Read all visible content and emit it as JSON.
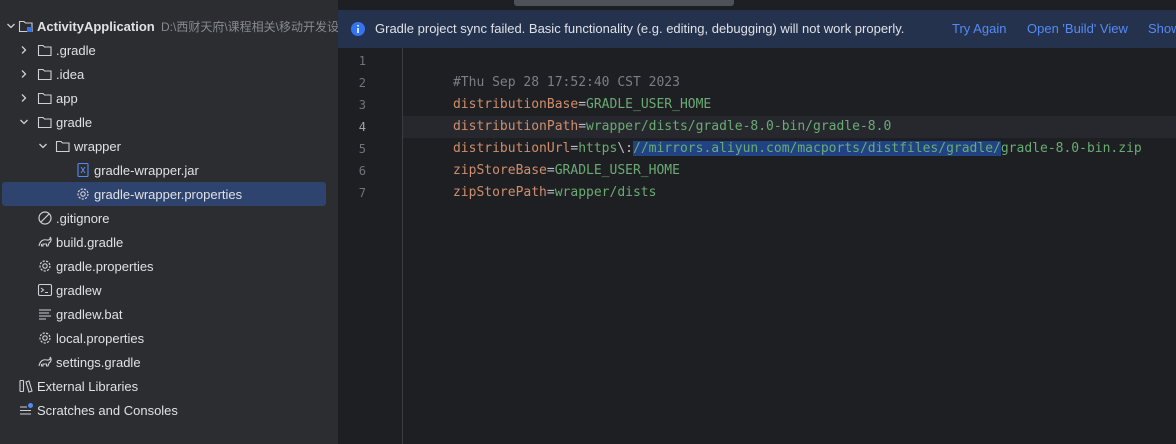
{
  "project": {
    "root_name": "ActivityApplication",
    "root_path": "D:\\西财天府\\课程相关\\移动开发设",
    "items": [
      {
        "label": ".gradle",
        "icon": "folder-icon"
      },
      {
        "label": ".idea",
        "icon": "folder-icon"
      },
      {
        "label": "app",
        "icon": "folder-icon"
      },
      {
        "label": "gradle",
        "icon": "folder-icon"
      },
      {
        "label": "wrapper",
        "icon": "folder-icon"
      },
      {
        "label": "gradle-wrapper.jar",
        "icon": "jar-file-icon"
      },
      {
        "label": "gradle-wrapper.properties",
        "icon": "properties-file-icon"
      },
      {
        "label": ".gitignore",
        "icon": "gitignore-icon"
      },
      {
        "label": "build.gradle",
        "icon": "gradle-icon"
      },
      {
        "label": "gradle.properties",
        "icon": "properties-file-icon"
      },
      {
        "label": "gradlew",
        "icon": "terminal-file-icon"
      },
      {
        "label": "gradlew.bat",
        "icon": "text-file-icon"
      },
      {
        "label": "local.properties",
        "icon": "properties-file-icon"
      },
      {
        "label": "settings.gradle",
        "icon": "gradle-icon"
      },
      {
        "label": "External Libraries",
        "icon": "libraries-icon"
      },
      {
        "label": "Scratches and Consoles",
        "icon": "scratches-icon"
      }
    ]
  },
  "banner": {
    "message": "Gradle project sync failed. Basic functionality (e.g. editing, debugging) will not work properly.",
    "try_again": "Try Again",
    "open_build": "Open 'Build' View",
    "show": "Show"
  },
  "editor": {
    "line_numbers": [
      "1",
      "2",
      "3",
      "4",
      "5",
      "6",
      "7"
    ],
    "comment": "#Thu Sep 28 17:52:40 CST 2023",
    "line2": {
      "key": "distributionBase",
      "eq": "=",
      "value": "GRADLE_USER_HOME"
    },
    "line3": {
      "key": "distributionPath",
      "eq": "=",
      "value": "wrapper/dists/gradle-8.0-bin/gradle-8.0"
    },
    "line4": {
      "key": "distributionUrl",
      "eq": "=",
      "value_a": "https",
      "escape": "\\:",
      "selected": "//mirrors.aliyun.com/macports/distfiles/gradle/",
      "value_b": "gradle-8.0-bin.zip"
    },
    "line5": {
      "key": "zipStoreBase",
      "eq": "=",
      "value": "GRADLE_USER_HOME"
    },
    "line6": {
      "key": "zipStorePath",
      "eq": "=",
      "value": "wrapper/dists"
    }
  },
  "colors": {
    "selection": "#2e436e",
    "banner_bg": "#25324d",
    "link": "#548af7",
    "folder": "#ced0d6"
  }
}
